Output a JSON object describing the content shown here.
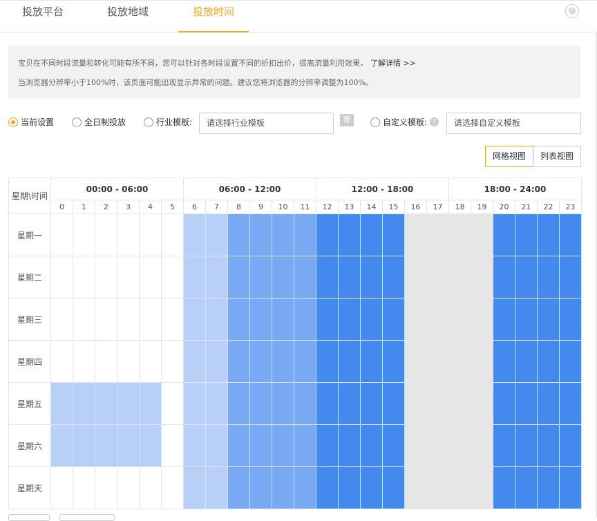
{
  "tabs": [
    {
      "label": "投放平台",
      "active": false
    },
    {
      "label": "投放地域",
      "active": false
    },
    {
      "label": "投放时间",
      "active": true
    }
  ],
  "close_icon": "⊗",
  "notice": {
    "line1": "宝贝在不同时段流量和转化可能有所不同，您可以针对各时段设置不同的折扣出价，提高流量利用效果，",
    "line1_link": "了解详情 >>",
    "line2": "当浏览器分辨率小于100%时，该页面可能出现显示异常的问题。建议您将浏览器的分辨率调整为100%。"
  },
  "options": {
    "current": "当前设置",
    "allday": "全日制投放",
    "industry": "行业模板:",
    "industry_placeholder": "请选择行业模板",
    "recommend": "荐",
    "custom": "自定义模板:",
    "custom_help": "?",
    "custom_placeholder": "请选择自定义模板"
  },
  "view_toggle": {
    "grid": "网格视图",
    "list": "列表视图"
  },
  "schedule": {
    "corner": "星期\\时间",
    "ranges": [
      "00:00 - 06:00",
      "06:00 - 12:00",
      "12:00 - 18:00",
      "18:00 - 24:00"
    ],
    "hours": [
      "0",
      "1",
      "2",
      "3",
      "4",
      "5",
      "6",
      "7",
      "8",
      "9",
      "10",
      "11",
      "12",
      "13",
      "14",
      "15",
      "16",
      "17",
      "18",
      "19",
      "20",
      "21",
      "22",
      "23"
    ],
    "days": [
      "星期一",
      "星期二",
      "星期三",
      "星期四",
      "星期五",
      "星期六",
      "星期天"
    ],
    "colors": {
      "none": "#ffffff",
      "light": "#b8d0f8",
      "mid": "#7aa9f4",
      "strong": "#4489ee",
      "deep": "#2570e8",
      "grey": "#e6e6e6"
    },
    "rows": [
      "nnnnnnLLMMMMSSSSggggSSSSDDDDDMM",
      "nnnnnnLLMMMMSSSSggggSSSSDDDDDMM",
      "nnnnnnLLMMMMSSSSggggSSSSDDDDDMM",
      "nnnnnnLLMMMMSSSSggggSSSSDDDDDMM",
      "LLLLLnLLMMMMSSSSggggSSSSDDDDDMM",
      "LLLLLnLLMMMMSSSSggggSSSSggggggS",
      "nnnnnnLLMMMMSSSSggggSSSSSSSSSSS"
    ]
  }
}
